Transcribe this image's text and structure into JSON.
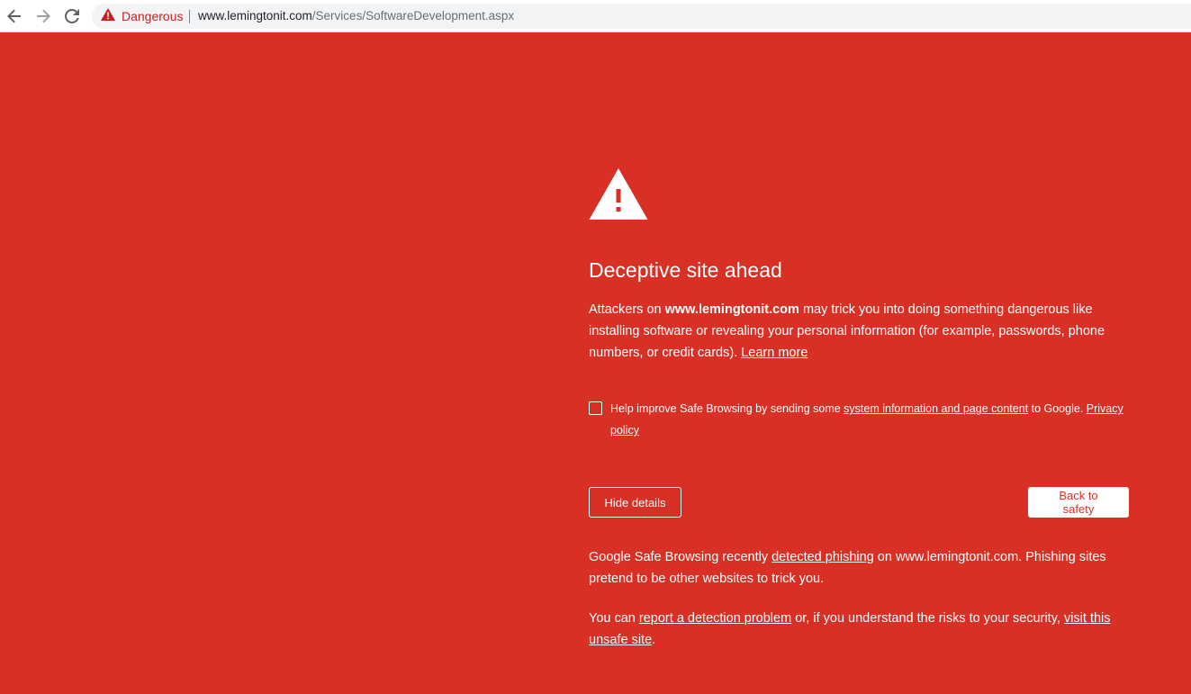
{
  "browser": {
    "security_label": "Dangerous",
    "url_host": "www.lemingtonit.com",
    "url_path": "/Services/SoftwareDevelopment.aspx",
    "colors": {
      "danger": "#d93025",
      "danger_text": "#c5221f",
      "toolbar": "#ffffff",
      "omnibox": "#f1f3f4"
    },
    "icons": {
      "back": "arrow-back-icon",
      "forward": "arrow-forward-icon",
      "reload": "reload-icon",
      "security": "warning-triangle-icon"
    }
  },
  "interstitial": {
    "background_color": "#d93025",
    "icon": "warning-triangle-icon",
    "heading": "Deceptive site ahead",
    "primary": {
      "prefix": "Attackers on ",
      "site": "www.lemingtonit.com",
      "suffix": " may trick you into doing something dangerous like installing software or revealing your personal information (for example, passwords, phone numbers, or credit cards). ",
      "learn_more": "Learn more"
    },
    "optin": {
      "checked": false,
      "prefix": "Help improve Safe Browsing by sending some ",
      "link": "system information and page content",
      "suffix": " to Google. ",
      "privacy_link": "Privacy policy"
    },
    "buttons": {
      "details": "Hide details",
      "safety": "Back to safety"
    },
    "details": {
      "p1_prefix": "Google Safe Browsing recently ",
      "p1_link": "detected phishing",
      "p1_suffix": " on www.lemingtonit.com. Phishing sites pretend to be other websites to trick you.",
      "p2_prefix": "You can ",
      "p2_link1": "report a detection problem",
      "p2_middle": " or, if you understand the risks to your security, ",
      "p2_link2": "visit this unsafe site",
      "p2_suffix": "."
    }
  }
}
